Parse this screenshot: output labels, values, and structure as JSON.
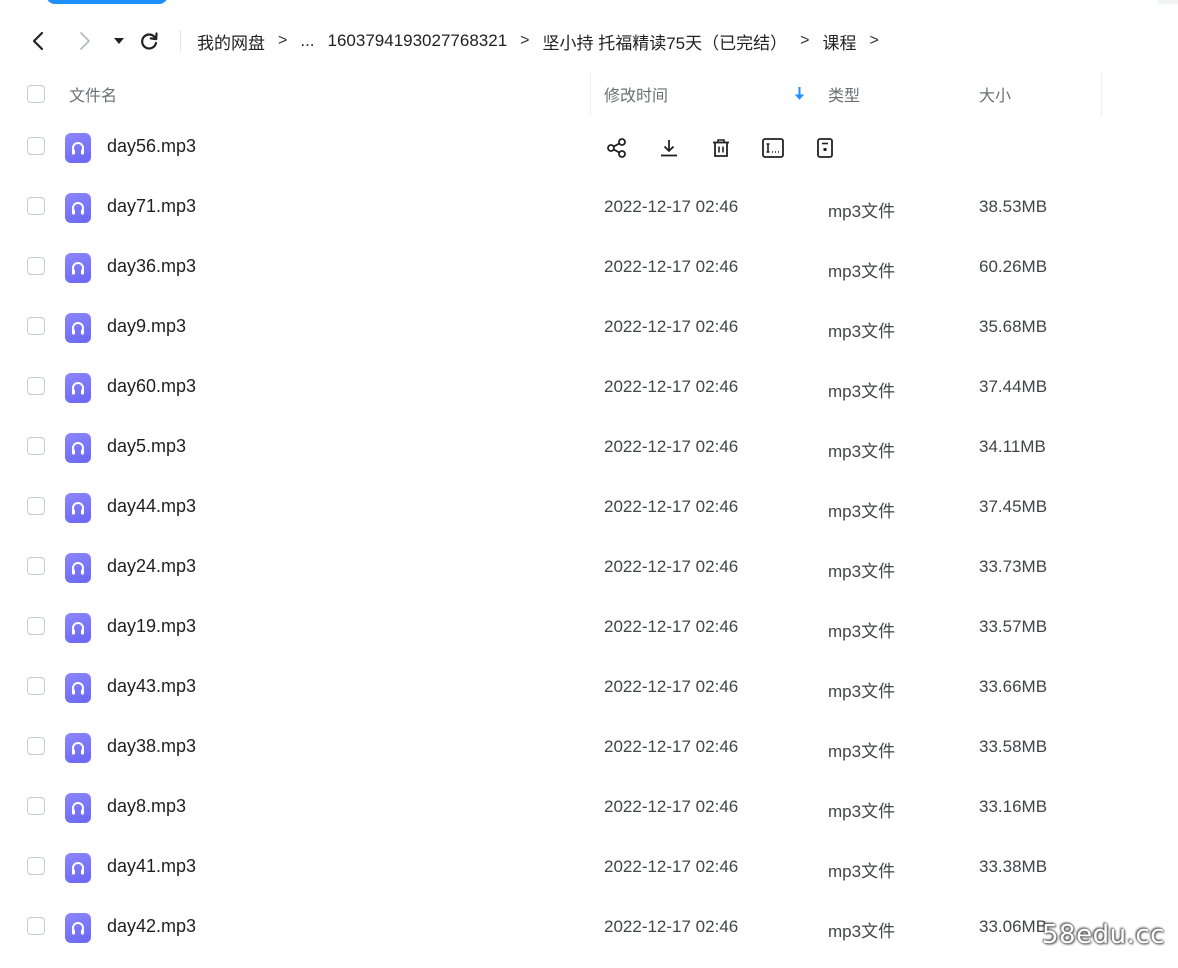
{
  "breadcrumb": {
    "items": [
      "我的网盘",
      "...",
      "1603794193027768321",
      "坚小持 托福精读75天（已完结）",
      "课程"
    ],
    "separator": ">"
  },
  "header": {
    "filename": "文件名",
    "modified": "修改时间",
    "type": "类型",
    "size": "大小"
  },
  "hover_row": {
    "name": "day56.mp3",
    "actions": [
      "share-icon",
      "download-icon",
      "delete-icon",
      "rename-icon",
      "more-icon"
    ]
  },
  "files": [
    {
      "name": "day71.mp3",
      "date": "2022-12-17 02:46",
      "type": "mp3文件",
      "size": "38.53MB"
    },
    {
      "name": "day36.mp3",
      "date": "2022-12-17 02:46",
      "type": "mp3文件",
      "size": "60.26MB"
    },
    {
      "name": "day9.mp3",
      "date": "2022-12-17 02:46",
      "type": "mp3文件",
      "size": "35.68MB"
    },
    {
      "name": "day60.mp3",
      "date": "2022-12-17 02:46",
      "type": "mp3文件",
      "size": "37.44MB"
    },
    {
      "name": "day5.mp3",
      "date": "2022-12-17 02:46",
      "type": "mp3文件",
      "size": "34.11MB"
    },
    {
      "name": "day44.mp3",
      "date": "2022-12-17 02:46",
      "type": "mp3文件",
      "size": "37.45MB"
    },
    {
      "name": "day24.mp3",
      "date": "2022-12-17 02:46",
      "type": "mp3文件",
      "size": "33.73MB"
    },
    {
      "name": "day19.mp3",
      "date": "2022-12-17 02:46",
      "type": "mp3文件",
      "size": "33.57MB"
    },
    {
      "name": "day43.mp3",
      "date": "2022-12-17 02:46",
      "type": "mp3文件",
      "size": "33.66MB"
    },
    {
      "name": "day38.mp3",
      "date": "2022-12-17 02:46",
      "type": "mp3文件",
      "size": "33.58MB"
    },
    {
      "name": "day8.mp3",
      "date": "2022-12-17 02:46",
      "type": "mp3文件",
      "size": "33.16MB"
    },
    {
      "name": "day41.mp3",
      "date": "2022-12-17 02:46",
      "type": "mp3文件",
      "size": "33.38MB"
    },
    {
      "name": "day42.mp3",
      "date": "2022-12-17 02:46",
      "type": "mp3文件",
      "size": "33.06MB"
    }
  ],
  "watermark": "58edu.cc",
  "colors": {
    "accent": "#1e8fff",
    "file_icon": "#7a76f8",
    "sort_arrow": "#1e8fff"
  }
}
